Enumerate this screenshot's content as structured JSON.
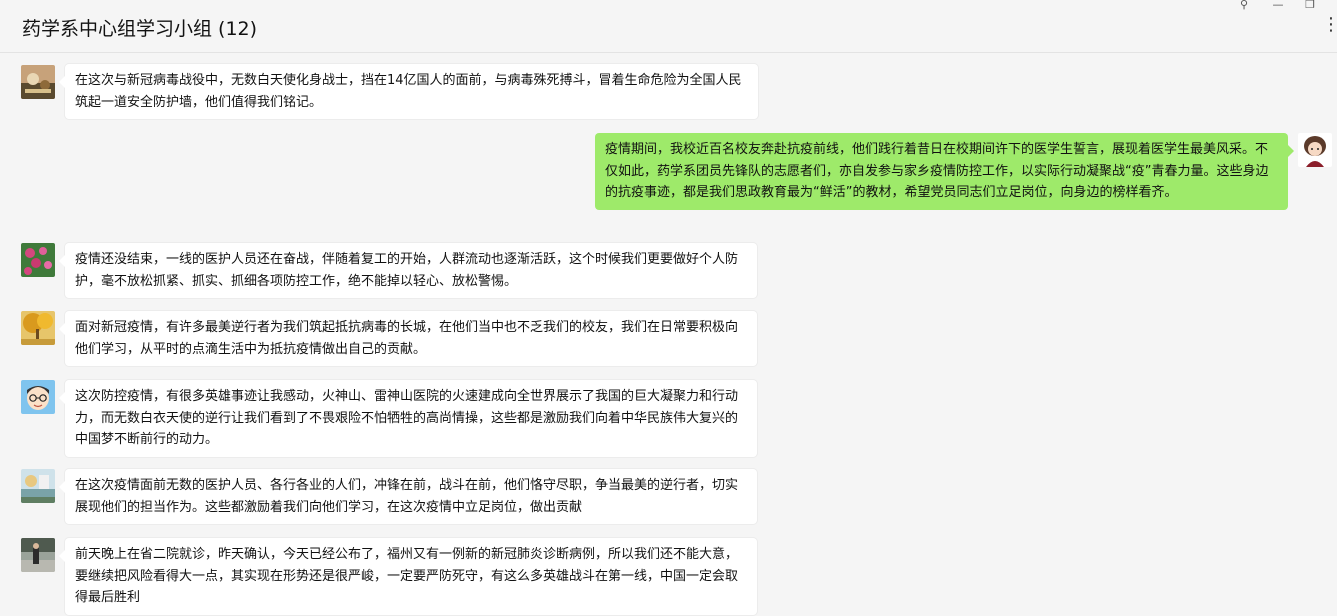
{
  "chat": {
    "title": "药学系中心组学习小组 (12)"
  },
  "window_controls": {
    "pin_glyph": "⚲",
    "minimize_glyph": "—",
    "maximize_glyph": "❐"
  },
  "more_glyph": "⋮",
  "messages": [
    {
      "side": "left",
      "avatar": "food-photo-avatar",
      "text": "在这次与新冠病毒战役中，无数白天使化身战士，挡在14亿国人的面前，与病毒殊死搏斗，冒着生命危险为全国人民筑起一道安全防护墙，他们值得我们铭记。"
    },
    {
      "side": "right",
      "avatar": "cartoon-girl-avatar",
      "text": "疫情期间，我校近百名校友奔赴抗疫前线，他们践行着昔日在校期间许下的医学生誓言，展现着医学生最美风采。不仅如此，药学系团员先锋队的志愿者们，亦自发参与家乡疫情防控工作，以实际行动凝聚战“疫”青春力量。这些身边的抗疫事迹，都是我们思政教育最为“鲜活”的教材，希望党员同志们立足岗位，向身边的榜样看齐。"
    },
    {
      "side": "left",
      "avatar": "flowers-avatar",
      "text": "疫情还没结束，一线的医护人员还在奋战，伴随着复工的开始，人群流动也逐渐活跃，这个时候我们更要做好个人防护，毫不放松抓紧、抓实、抓细各项防控工作，绝不能掉以轻心、放松警惕。"
    },
    {
      "side": "left",
      "avatar": "autumn-tree-avatar",
      "text": "面对新冠疫情，有许多最美逆行者为我们筑起抵抗病毒的长城，在他们当中也不乏我们的校友，我们在日常要积极向他们学习，从平时的点滴生活中为抵抗疫情做出自己的贡献。"
    },
    {
      "side": "left",
      "avatar": "cartoon-boy-avatar",
      "text": "这次防控疫情，有很多英雄事迹让我感动，火神山、雷神山医院的火速建成向全世界展示了我国的巨大凝聚力和行动力，而无数白衣天使的逆行让我们看到了不畏艰险不怕牺牲的高尚情操，这些都是激励我们向着中华民族伟大复兴的中国梦不断前行的动力。"
    },
    {
      "side": "left",
      "avatar": "landscape-avatar",
      "text": "在这次疫情面前无数的医护人员、各行各业的人们，冲锋在前，战斗在前，他们恪守尽职，争当最美的逆行者，切实展现他们的担当作为。这些都激励着我们向他们学习，在这次疫情中立足岗位，做出贡献"
    },
    {
      "side": "left",
      "avatar": "street-photo-avatar",
      "text": "前天晚上在省二院就诊，昨天确认，今天已经公布了，福州又有一例新的新冠肺炎诊断病例，所以我们还不能大意，要继续把风险看得大一点，其实现在形势还是很严峻，一定要严防死守，有这么多英雄战斗在第一线，中国一定会取得最后胜利"
    }
  ]
}
